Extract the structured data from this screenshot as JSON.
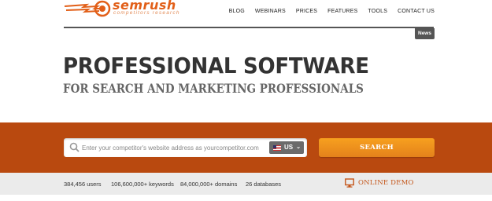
{
  "brand": {
    "name": "semrush",
    "tagline": "competitors research",
    "color": "#e25f18"
  },
  "nav": {
    "items": [
      "BLOG",
      "WEBINARS",
      "PRICES",
      "FEATURES",
      "TOOLS",
      "CONTACT US"
    ]
  },
  "news_tab": "News",
  "hero": {
    "title": "PROFESSIONAL SOFTWARE",
    "subtitle": "FOR SEARCH AND MARKETING PROFESSIONALS"
  },
  "search": {
    "placeholder": "Enter your competitor's website address as yourcompetitor.com",
    "value": "",
    "country": "US",
    "button_label": "SEARCH",
    "band_color": "#b9490f",
    "button_color": "#f39a1e"
  },
  "stats": {
    "users": "384,456 users",
    "keywords": "106,600,000+ keywords",
    "domains": "84,000,000+ domains",
    "databases": "26 databases"
  },
  "demo": {
    "label": "ONLINE DEMO",
    "icon": "monitor-icon"
  }
}
